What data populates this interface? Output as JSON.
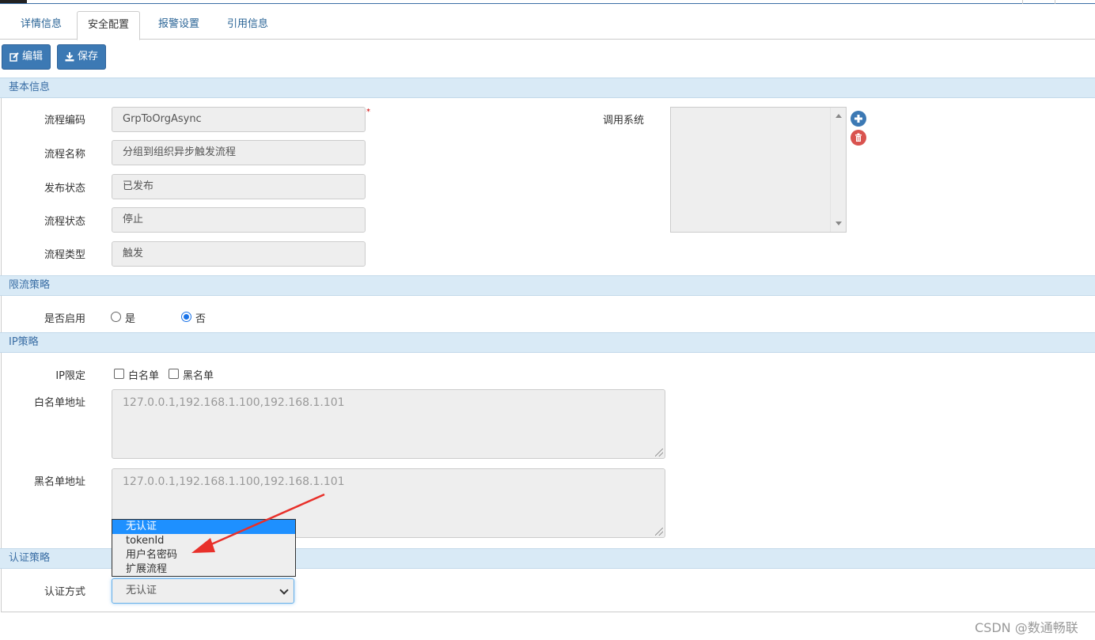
{
  "tabs": [
    "详情信息",
    "安全配置",
    "报警设置",
    "引用信息"
  ],
  "toolbar": {
    "edit_label": "编辑",
    "save_label": "保存"
  },
  "sections": {
    "basic": "基本信息",
    "rate_limit": "限流策略",
    "ip": "IP策略",
    "auth": "认证策略"
  },
  "basic": {
    "code_label": "流程编码",
    "code_value": "GrpToOrgAsync",
    "name_label": "流程名称",
    "name_value": "分组到组织异步触发流程",
    "publish_label": "发布状态",
    "publish_value": "已发布",
    "state_label": "流程状态",
    "state_value": "停止",
    "type_label": "流程类型",
    "type_value": "触发",
    "required_mark": "*",
    "caller_label": "调用系统"
  },
  "rate_limit": {
    "enable_label": "是否启用",
    "yes": "是",
    "no": "否",
    "selected": "否"
  },
  "ip": {
    "limit_label": "IP限定",
    "whitelist_opt": "白名单",
    "blacklist_opt": "黑名单",
    "whitelist_label": "白名单地址",
    "whitelist_value": "127.0.0.1,192.168.1.100,192.168.1.101",
    "blacklist_label": "黑名单地址",
    "blacklist_value": "127.0.0.1,192.168.1.100,192.168.1.101"
  },
  "auth": {
    "method_label": "认证方式",
    "selected": "无认证",
    "options": [
      "无认证",
      "tokenId",
      "用户名密码",
      "扩展流程"
    ]
  },
  "watermark": "CSDN @数通畅联",
  "colors": {
    "accent": "#3c79b4",
    "section_bg": "#d9eaf6",
    "selection": "#1e90ff",
    "arrow": "#e8302a"
  }
}
